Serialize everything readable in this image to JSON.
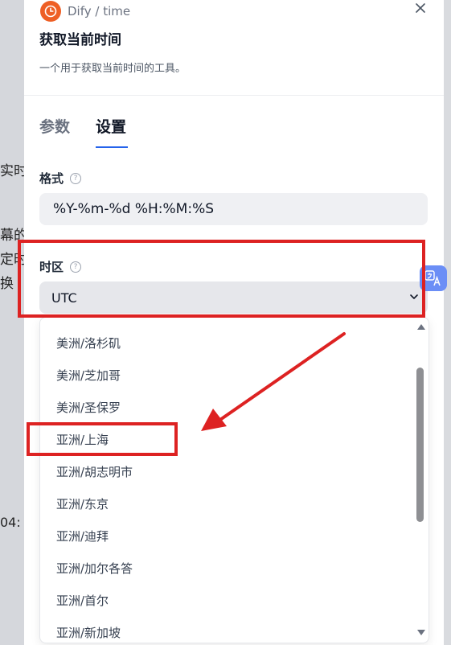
{
  "background": {
    "fragments": [
      "实时",
      "幕的",
      "定时",
      "换",
      "04:"
    ]
  },
  "header": {
    "provider": "Dify / time",
    "title": "获取当前时间",
    "description": "一个用于获取当前时间的工具。"
  },
  "tabs": [
    {
      "label": "参数",
      "active": false
    },
    {
      "label": "设置",
      "active": true
    }
  ],
  "settings": {
    "format_label": "格式",
    "format_value": "%Y-%m-%d %H:%M:%S",
    "timezone_label": "时区",
    "timezone_value": "UTC"
  },
  "dropdown": {
    "options": [
      "美洲/洛杉矶",
      "美洲/芝加哥",
      "美洲/圣保罗",
      "亚洲/上海",
      "亚洲/胡志明市",
      "亚洲/东京",
      "亚洲/迪拜",
      "亚洲/加尔各答",
      "亚洲/首尔",
      "亚洲/新加坡"
    ],
    "highlighted": "亚洲/上海"
  },
  "icons": {
    "logo": "clock-icon",
    "close": "close-icon",
    "help": "help-icon",
    "chevron": "chevron-down-icon",
    "translate": "translate-icon"
  },
  "colors": {
    "brand_orange": "#ee5f25",
    "tab_underline": "#2563eb",
    "annotation_red": "#dd2222"
  }
}
